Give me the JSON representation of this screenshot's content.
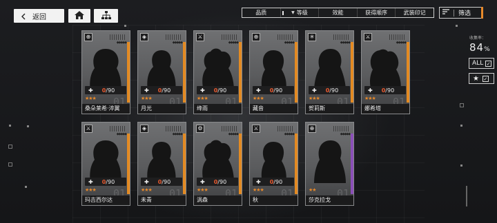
{
  "nav": {
    "back_label": "返回",
    "back_icon": "chevron-left-icon",
    "home_icon": "home-icon",
    "tree_icon": "hierarchy-icon"
  },
  "sort_bar": {
    "items": [
      "品质",
      "等级",
      "效能",
      "获得顺序",
      "武装印记"
    ],
    "active_index": 1
  },
  "filter": {
    "label": "筛选",
    "icon": "filter-list-icon"
  },
  "collection": {
    "label": "收集率：",
    "value": "84",
    "unit": "%"
  },
  "toggles": {
    "all_label": "ALL",
    "all_checked": "✓",
    "star_label": "★",
    "star_checked": "✓"
  },
  "colors": {
    "accent_orange": "#e8892a",
    "rarity_purple": "#8b4fb8",
    "count_red": "#e85a30"
  },
  "cards": [
    {
      "name": "桑朵莱希·淬翼",
      "count": "0",
      "max": "/90",
      "stars": "★★★",
      "class_icon": "crosshair-icon",
      "stripe": "orange"
    },
    {
      "name": "月光",
      "count": "0",
      "max": "/90",
      "stars": "★★★",
      "class_icon": "shield-icon",
      "stripe": "orange"
    },
    {
      "name": "绛雨",
      "count": "0",
      "max": "/90",
      "stars": "★★★",
      "class_icon": "sword-icon",
      "stripe": "orange"
    },
    {
      "name": "藏音",
      "count": "0",
      "max": "/90",
      "stars": "★★★",
      "class_icon": "crosshair-icon",
      "stripe": "orange"
    },
    {
      "name": "贺莉斯",
      "count": "0",
      "max": "/90",
      "stars": "★★★",
      "class_icon": "star-burst-icon",
      "stripe": "orange"
    },
    {
      "name": "娜希塔",
      "count": "0",
      "max": "/90",
      "stars": "★★★",
      "class_icon": "sword-icon",
      "stripe": "orange"
    },
    {
      "name": "玛吉西尔达",
      "count": "0",
      "max": "/90",
      "stars": "★★★",
      "class_icon": "sword-icon",
      "stripe": "orange"
    },
    {
      "name": "未青",
      "count": "0",
      "max": "/90",
      "stars": "★★★",
      "class_icon": "shield-icon",
      "stripe": "orange"
    },
    {
      "name": "涡森",
      "count": "0",
      "max": "/90",
      "stars": "★★★",
      "class_icon": "gear-icon",
      "stripe": "orange"
    },
    {
      "name": "秋",
      "count": "0",
      "max": "/90",
      "stars": "★★★",
      "class_icon": "sword-icon",
      "stripe": "orange"
    },
    {
      "name": "莎克拉戈",
      "count": "",
      "max": "",
      "stars": "★★",
      "class_icon": "crosshair-icon",
      "stripe": "purple"
    }
  ]
}
